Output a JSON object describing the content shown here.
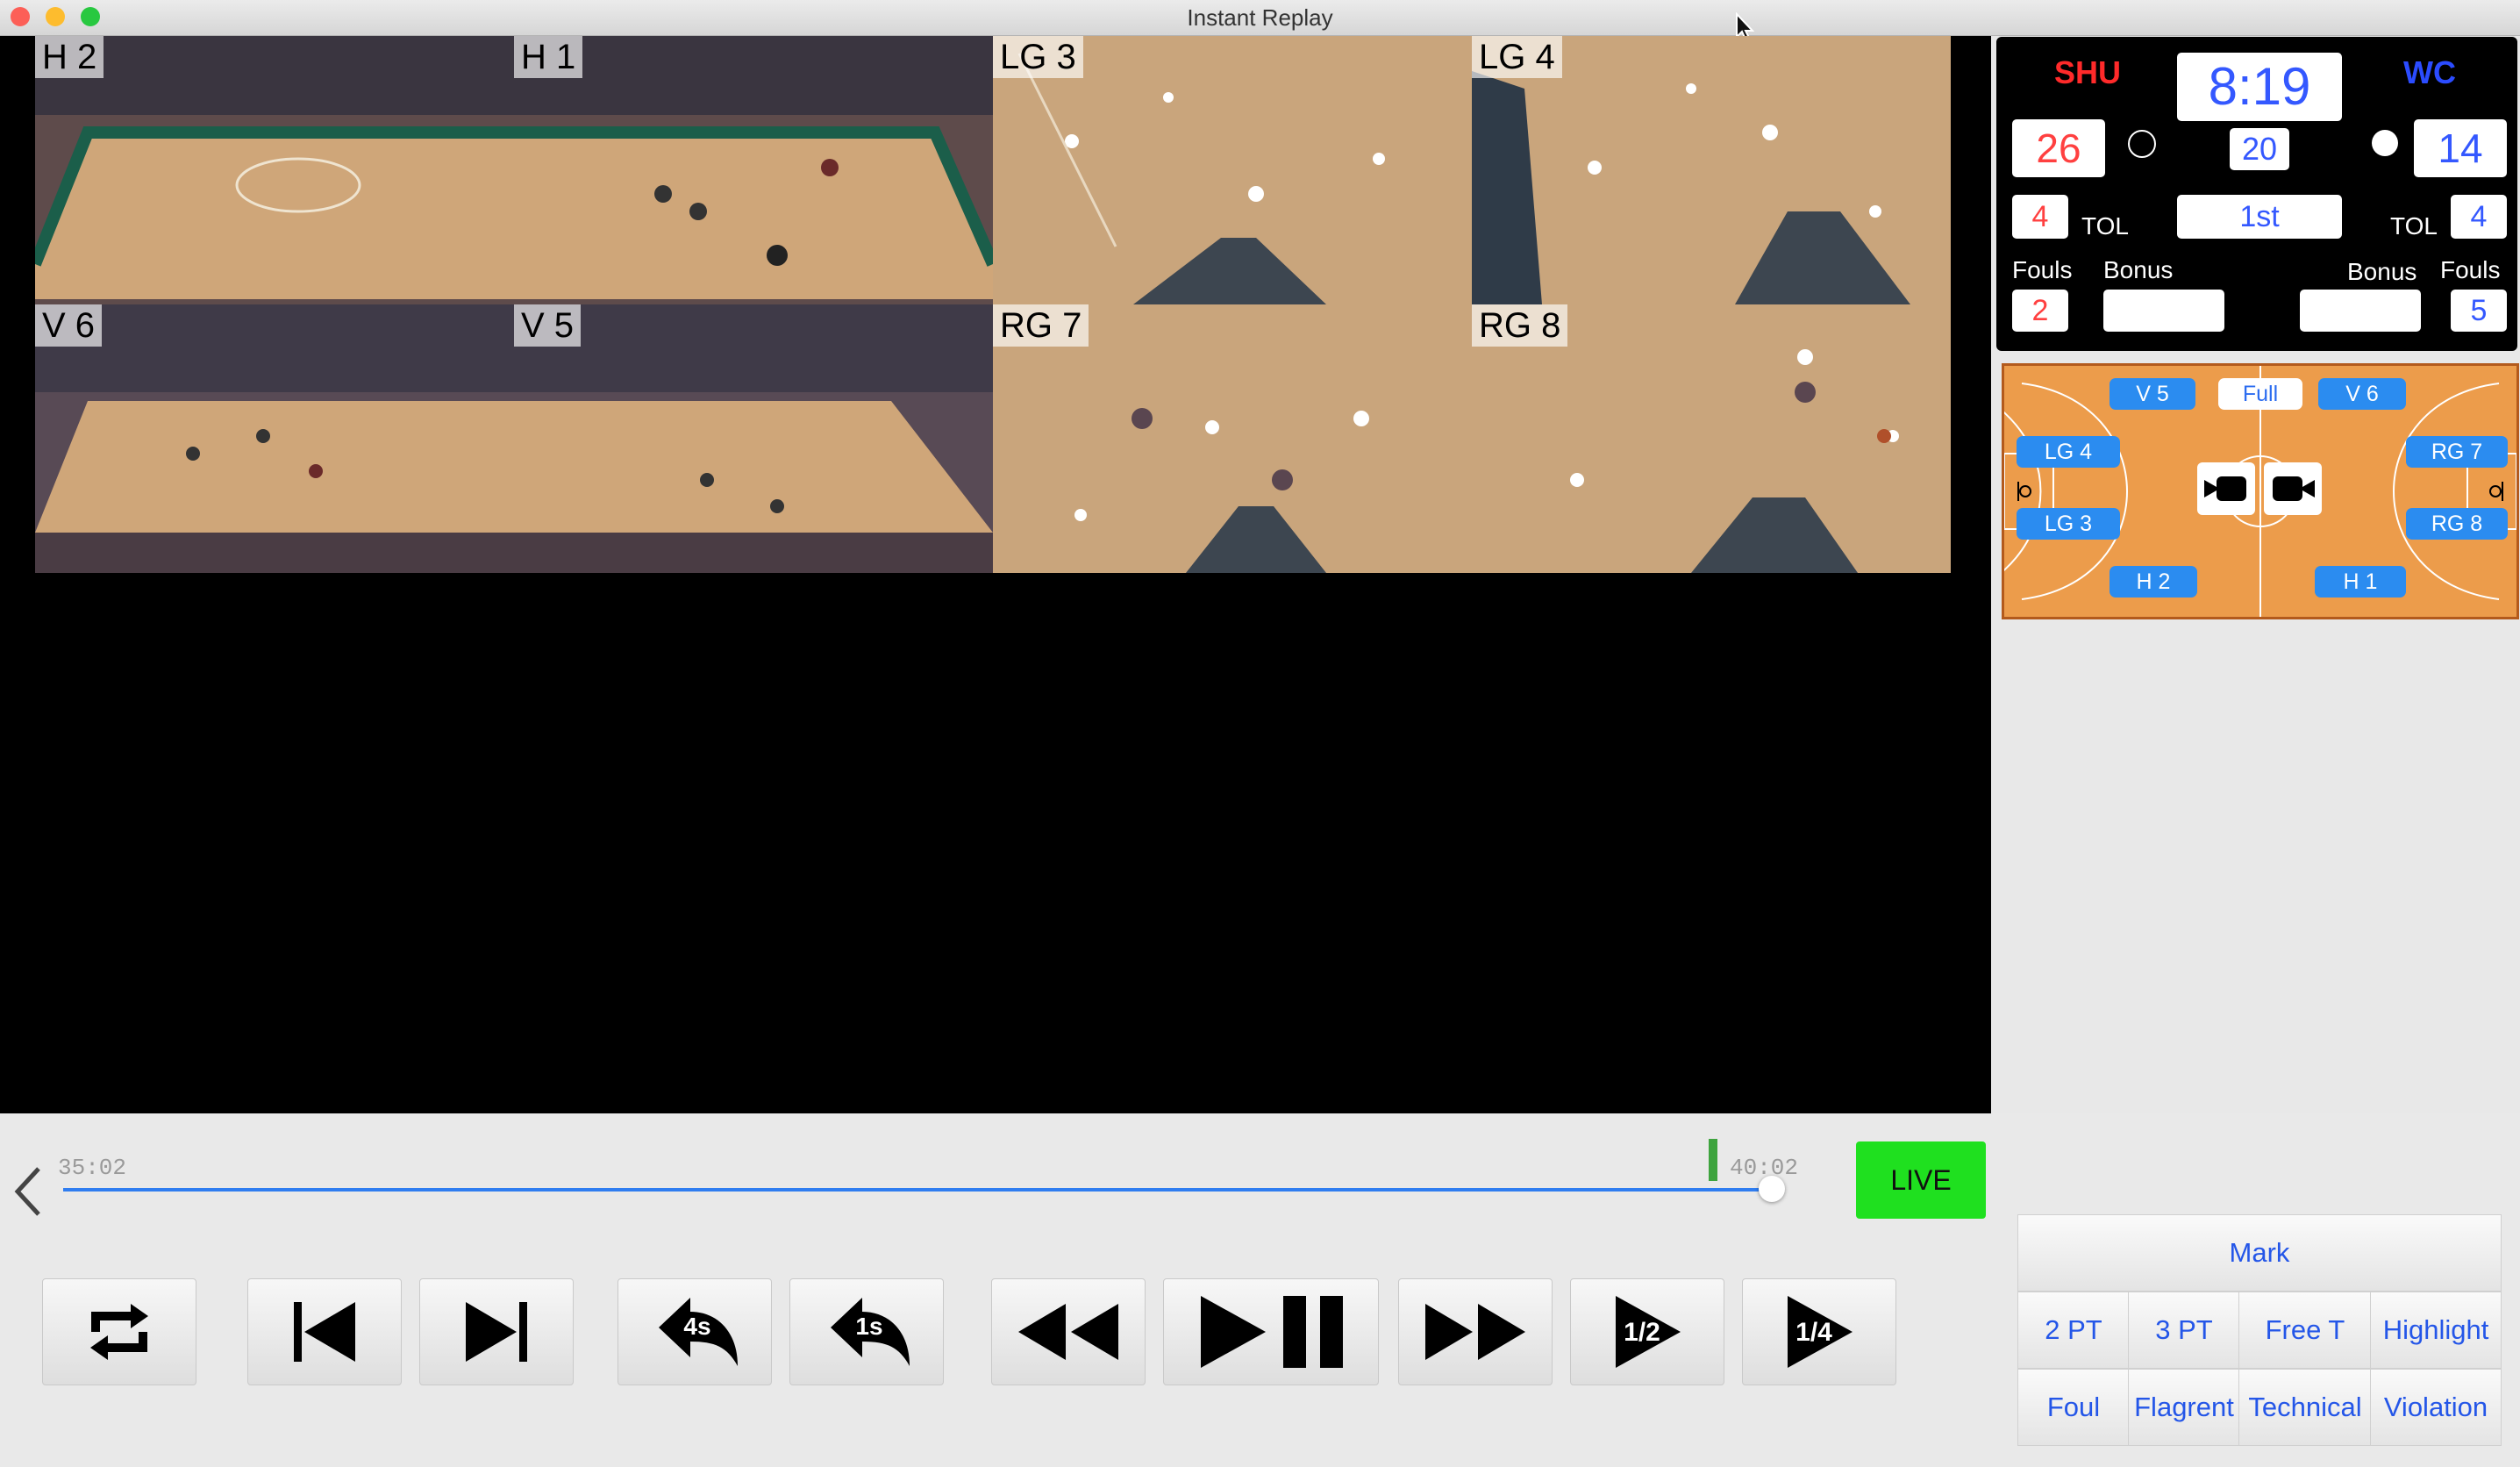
{
  "window": {
    "title": "Instant Replay"
  },
  "cameras": [
    {
      "label": "H 2"
    },
    {
      "label": "H 1"
    },
    {
      "label": "LG 3"
    },
    {
      "label": "LG 4"
    },
    {
      "label": "V 6"
    },
    {
      "label": "V 5"
    },
    {
      "label": "RG 7"
    },
    {
      "label": "RG 8"
    }
  ],
  "scoreboard": {
    "home_team": "SHU",
    "away_team": "WC",
    "clock": "8:19",
    "home_score": "26",
    "away_score": "14",
    "shot_clock": "20",
    "period": "1st",
    "home_tol": "4",
    "away_tol": "4",
    "tol_label": "TOL",
    "fouls_label": "Fouls",
    "bonus_label": "Bonus",
    "home_fouls": "2",
    "away_fouls": "5",
    "home_bonus": "",
    "away_bonus": "",
    "home_color": "#ff2a2a",
    "away_color": "#2b4cff"
  },
  "court_map": {
    "buttons": {
      "v5": "V 5",
      "full": "Full",
      "v6": "V 6",
      "lg4": "LG 4",
      "lg3": "LG 3",
      "rg7": "RG 7",
      "rg8": "RG 8",
      "h2": "H 2",
      "h1": "H 1"
    }
  },
  "timeline": {
    "start": "35:02",
    "end": "40:02",
    "live_label": "LIVE",
    "live_color": "#1fe01f",
    "progress": 1.0
  },
  "controls": {
    "rewind_4s": "4s",
    "rewind_1s": "1s",
    "half_speed": "1/2",
    "quarter_speed": "1/4"
  },
  "mark_panel": {
    "mark": "Mark",
    "row1": [
      "2 PT",
      "3 PT",
      "Free T",
      "Highlight"
    ],
    "row2": [
      "Foul",
      "Flagrent",
      "Technical",
      "Violation"
    ]
  }
}
